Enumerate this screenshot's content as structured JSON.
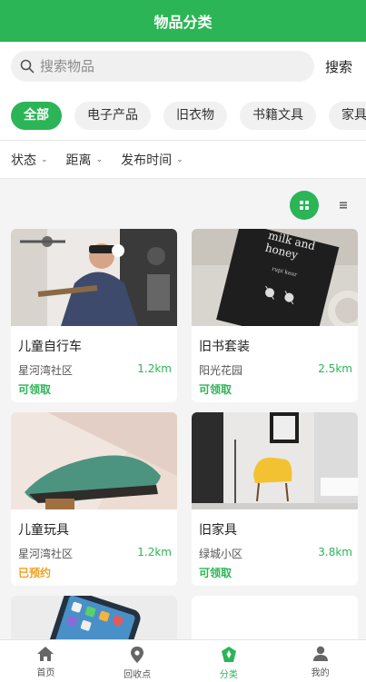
{
  "header": {
    "title": "物品分类"
  },
  "search": {
    "placeholder": "搜索物品",
    "button_label": "搜索"
  },
  "categories": [
    {
      "label": "全部",
      "active": true
    },
    {
      "label": "电子产品"
    },
    {
      "label": "旧衣物"
    },
    {
      "label": "书籍文具"
    },
    {
      "label": "家具"
    }
  ],
  "filters": [
    {
      "label": "状态"
    },
    {
      "label": "距离"
    },
    {
      "label": "发布时间"
    }
  ],
  "items": [
    {
      "title": "儿童自行车",
      "location": "星河湾社区",
      "distance": "1.2km",
      "status": "可领取",
      "status_type": "available"
    },
    {
      "title": "旧书套装",
      "location": "阳光花园",
      "distance": "2.5km",
      "status": "可领取",
      "status_type": "available",
      "book_title": "milk and honey",
      "book_author": "rupi kaur"
    },
    {
      "title": "儿童玩具",
      "location": "星河湾社区",
      "distance": "1.2km",
      "status": "已预约",
      "status_type": "reserved"
    },
    {
      "title": "旧家具",
      "location": "绿城小区",
      "distance": "3.8km",
      "status": "可领取",
      "status_type": "available"
    }
  ],
  "tabbar": [
    {
      "label": "首页",
      "icon": "home-icon"
    },
    {
      "label": "回收点",
      "icon": "location-pin-icon"
    },
    {
      "label": "分类",
      "icon": "category-icon",
      "active": true
    },
    {
      "label": "我的",
      "icon": "user-icon"
    }
  ],
  "colors": {
    "accent": "#2bb556",
    "reserved": "#f0a020"
  }
}
